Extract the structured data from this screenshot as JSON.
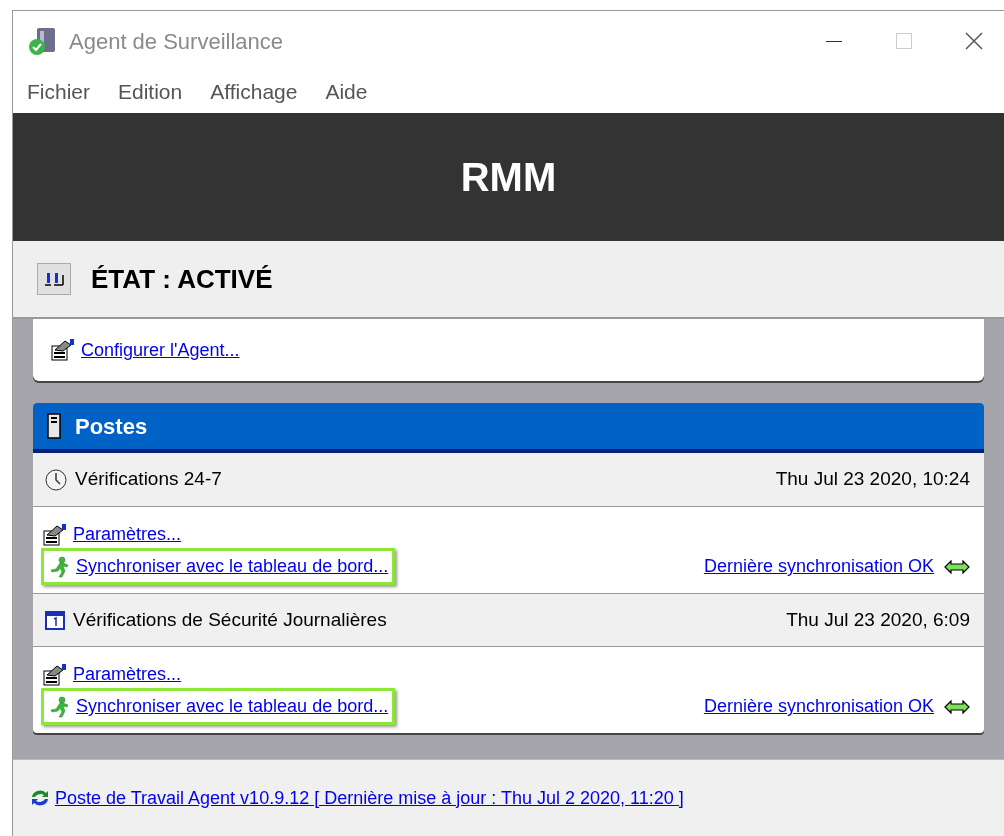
{
  "window": {
    "title": "Agent de Surveillance"
  },
  "menu": [
    "Fichier",
    "Edition",
    "Affichage",
    "Aide"
  ],
  "banner": {
    "title": "RMM"
  },
  "status": {
    "label": "ÉTAT : ACTIVÉ"
  },
  "config_link": "Configurer l'Agent...",
  "panel": {
    "title": "Postes",
    "checks": [
      {
        "kind": "clock",
        "name": "Vérifications 24-7",
        "time": "Thu Jul 23 2020, 10:24",
        "settings_link": "Paramètres...",
        "sync_link": "Synchroniser avec le tableau de bord...",
        "highlighted": true,
        "sync_status": "Dernière synchronisation OK"
      },
      {
        "kind": "calendar",
        "name": "Vérifications de Sécurité Journalières",
        "time": "Thu Jul 23 2020, 6:09",
        "settings_link": "Paramètres...",
        "sync_link": "Synchroniser avec le tableau de bord...",
        "highlighted": true,
        "sync_status": "Dernière synchronisation OK"
      }
    ]
  },
  "footer_link": "Poste de Travail Agent v10.9.12 [ Dernière mise à jour : Thu Jul 2 2020, 11:20 ]"
}
